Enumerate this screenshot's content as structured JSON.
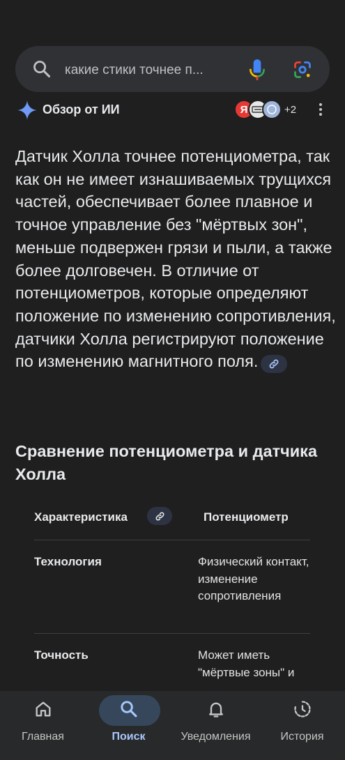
{
  "search": {
    "query": "какие стики точнее п..."
  },
  "ai_overview": {
    "title": "Обзор от ИИ",
    "source_badges": [
      "Я"
    ],
    "more_sources": "+2",
    "summary": "Датчик Холла точнее потенциометра, так как он не имеет изнашиваемых трущихся частей, обеспечивает более плавное и точное управление без \"мёртвых зон\", меньше подвержен грязи и пыли, а также более долговечен. В отличие от потенциометров, которые определяют положение по изменению сопротивления, датчики Холла регистрируют положение по изменению магнитного поля."
  },
  "comparison": {
    "heading": "Сравнение потенциометра и датчика Холла",
    "headers": [
      "Характеристика",
      "Потенциометр"
    ],
    "rows": [
      {
        "label": "Технология",
        "value": "Физический контакт, изменение сопротивления"
      },
      {
        "label": "Точность",
        "value": "Может иметь \"мёртвые зоны\" и"
      }
    ]
  },
  "bottom_nav": [
    {
      "label": "Главная",
      "icon": "home-icon",
      "active": false
    },
    {
      "label": "Поиск",
      "icon": "search-icon",
      "active": true
    },
    {
      "label": "Уведомления",
      "icon": "bell-icon",
      "active": false
    },
    {
      "label": "История",
      "icon": "history-icon",
      "active": false
    }
  ],
  "colors": {
    "background": "#1f1f1f",
    "search_bar": "#303134",
    "active_nav": "#a8c7fa",
    "active_pill": "#36475c"
  }
}
